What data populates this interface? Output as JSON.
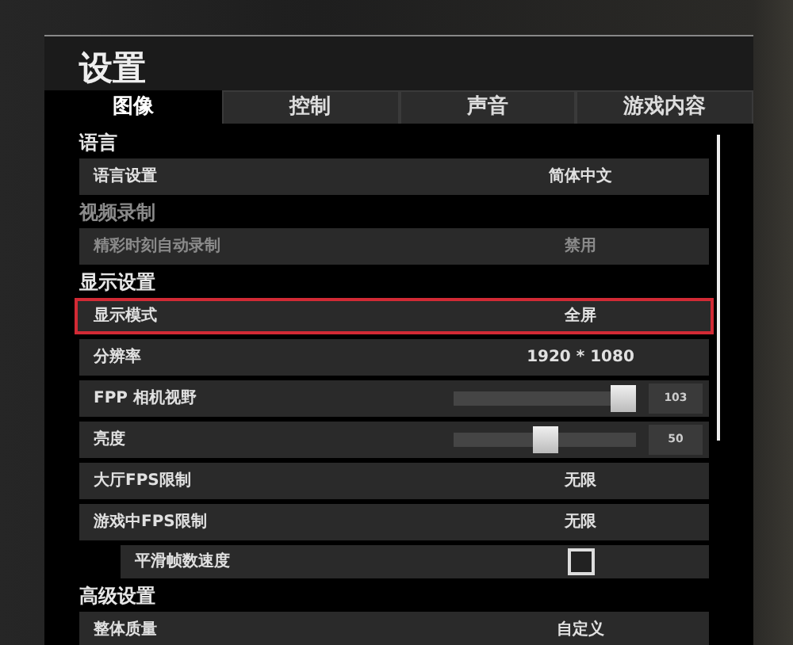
{
  "window": {
    "title": "设置"
  },
  "tabs": [
    {
      "label": "图像",
      "selected": true
    },
    {
      "label": "控制",
      "selected": false
    },
    {
      "label": "声音",
      "selected": false
    },
    {
      "label": "游戏内容",
      "selected": false
    }
  ],
  "sections": [
    {
      "title": "语言",
      "disabled": false,
      "rows": [
        {
          "kind": "select",
          "label": "语言设置",
          "value": "简体中文",
          "disabled": false,
          "selected": false
        }
      ]
    },
    {
      "title": "视频录制",
      "disabled": true,
      "rows": [
        {
          "kind": "select",
          "label": "精彩时刻自动录制",
          "value": "禁用",
          "disabled": true,
          "selected": false
        }
      ]
    },
    {
      "title": "显示设置",
      "disabled": false,
      "rows": [
        {
          "kind": "select",
          "label": "显示模式",
          "value": "全屏",
          "disabled": false,
          "selected": true
        },
        {
          "kind": "select",
          "label": "分辨率",
          "value": "1920 * 1080",
          "disabled": false,
          "selected": false
        },
        {
          "kind": "slider",
          "label": "FPP 相机视野",
          "value": "103",
          "level": 1.0,
          "disabled": false,
          "selected": false
        },
        {
          "kind": "slider",
          "label": "亮度",
          "value": "50",
          "level": 0.5,
          "disabled": false,
          "selected": false
        },
        {
          "kind": "select",
          "label": "大厅FPS限制",
          "value": "无限",
          "disabled": false,
          "selected": false
        },
        {
          "kind": "select",
          "label": "游戏中FPS限制",
          "value": "无限",
          "disabled": false,
          "selected": false
        },
        {
          "kind": "checkbox",
          "label": "平滑帧数速度",
          "checked": false,
          "disabled": false,
          "selected": false
        }
      ]
    },
    {
      "title": "高级设置",
      "disabled": false,
      "rows": [
        {
          "kind": "select",
          "label": "整体质量",
          "value": "自定义",
          "disabled": false,
          "selected": false
        }
      ]
    }
  ]
}
